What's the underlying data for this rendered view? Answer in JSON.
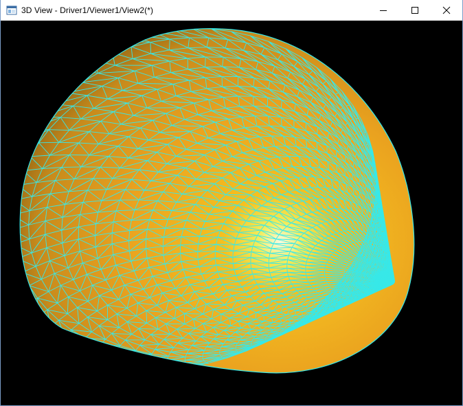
{
  "window": {
    "title": "3D View - Driver1/Viewer1/View2(*)",
    "icons": {
      "app": "3d-view-window-icon",
      "minimize": "minimize-icon",
      "maximize": "maximize-icon",
      "close": "close-icon"
    }
  },
  "viewport": {
    "background_color": "#000000",
    "model": {
      "shape": "ellipsoid-dome",
      "shading": "smooth-shaded",
      "surface_color": "#f4ae22",
      "highlight_color": "#f6fbe0",
      "wireframe_color": "#38e8e8",
      "display_mode": "shaded-with-edges"
    }
  }
}
